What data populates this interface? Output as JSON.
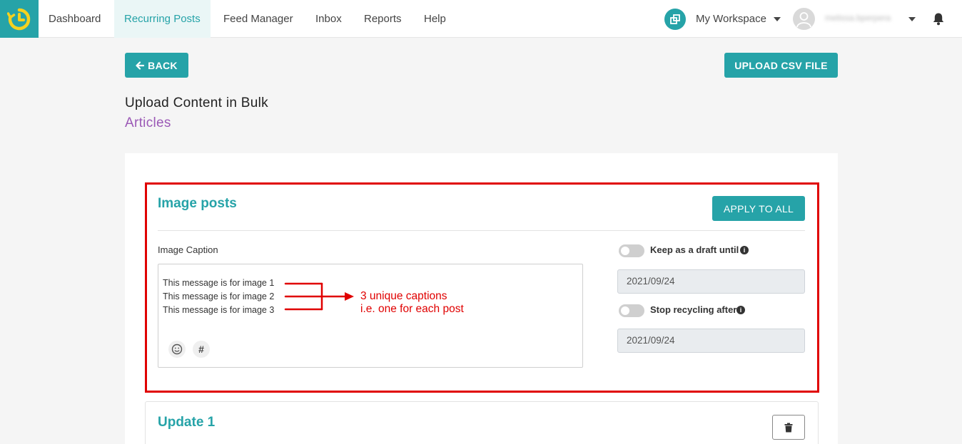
{
  "nav": {
    "items": [
      "Dashboard",
      "Recurring Posts",
      "Feed Manager",
      "Inbox",
      "Reports",
      "Help"
    ],
    "workspace_label": "My Workspace",
    "username": "melissa.bperpera"
  },
  "toolbar": {
    "back_label": "BACK",
    "upload_label": "UPLOAD CSV FILE"
  },
  "page": {
    "title": "Upload Content in Bulk",
    "subtitle": "Articles"
  },
  "image_posts": {
    "title": "Image posts",
    "apply_label": "APPLY TO ALL",
    "caption_label": "Image Caption",
    "captions": [
      "This message is for image 1",
      "This message is for image 2",
      "This message is for image 3"
    ],
    "draft_label": "Keep as a draft until",
    "draft_date": "2021/09/24",
    "stop_label": "Stop recycling after",
    "stop_date": "2021/09/24"
  },
  "annotation": {
    "line1": "3 unique captions",
    "line2": "i.e. one for each post"
  },
  "update": {
    "title": "Update 1"
  },
  "colors": {
    "accent": "#26a3a8",
    "subtitle": "#9b59b6",
    "annotation": "#e00000"
  }
}
